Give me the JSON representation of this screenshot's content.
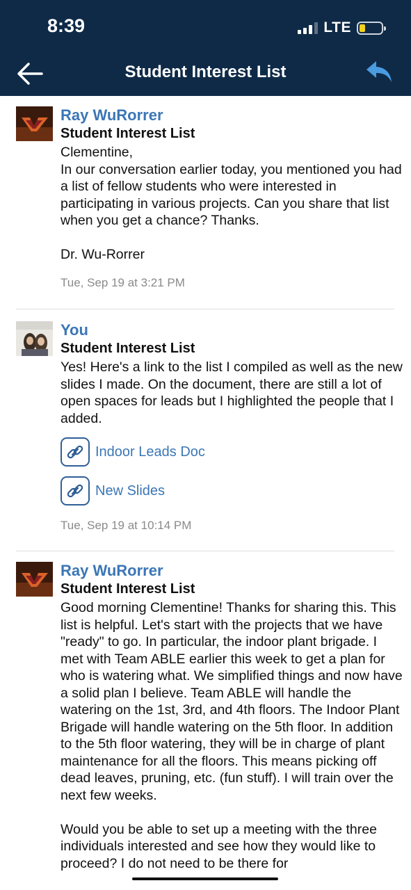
{
  "status_bar": {
    "time": "8:39",
    "network": "LTE"
  },
  "nav": {
    "title": "Student Interest List"
  },
  "messages": [
    {
      "sender": "Ray WuRorrer",
      "subject": "Student Interest List",
      "body": "Clementine,\nIn our conversation earlier today, you mentioned you had a list of fellow students who were interested in participating in various projects. Can you share that list when you get a chance? Thanks.\n\nDr. Wu-Rorrer",
      "time": "Tue, Sep 19 at 3:21 PM"
    },
    {
      "sender": "You",
      "subject": "Student Interest List",
      "body": "Yes! Here's a link to the list I compiled as well as the new slides I made. On the document, there are still a lot of open spaces for leads but I highlighted the people that I added.",
      "attachments": [
        {
          "label": "Indoor Leads Doc",
          "icon": "link-icon"
        },
        {
          "label": "New Slides",
          "icon": "link-icon"
        }
      ],
      "time": "Tue, Sep 19 at 10:14 PM"
    },
    {
      "sender": "Ray WuRorrer",
      "subject": "Student Interest List",
      "body": "Good morning Clementine! Thanks for sharing this. This list is helpful. Let's start with the projects that we have \"ready\" to go. In particular, the indoor plant brigade. I met with Team ABLE earlier this week to get a plan for who is watering what. We simplified things and now have a solid plan I believe.  Team ABLE will handle the watering on the 1st, 3rd, and 4th floors. The Indoor Plant Brigade will handle watering on the 5th floor. In addition to the 5th floor watering, they will be in charge of plant maintenance for all the floors. This means picking off dead leaves, pruning, etc. (fun stuff). I will train over the next few weeks.\n\nWould you be able to set up a meeting with the three individuals interested and see how they would like to proceed? I do not need to be there for"
    }
  ],
  "colors": {
    "header_bg": "#0e2a47",
    "sender": "#3b76b6",
    "timestamp": "#8a8a8a"
  }
}
